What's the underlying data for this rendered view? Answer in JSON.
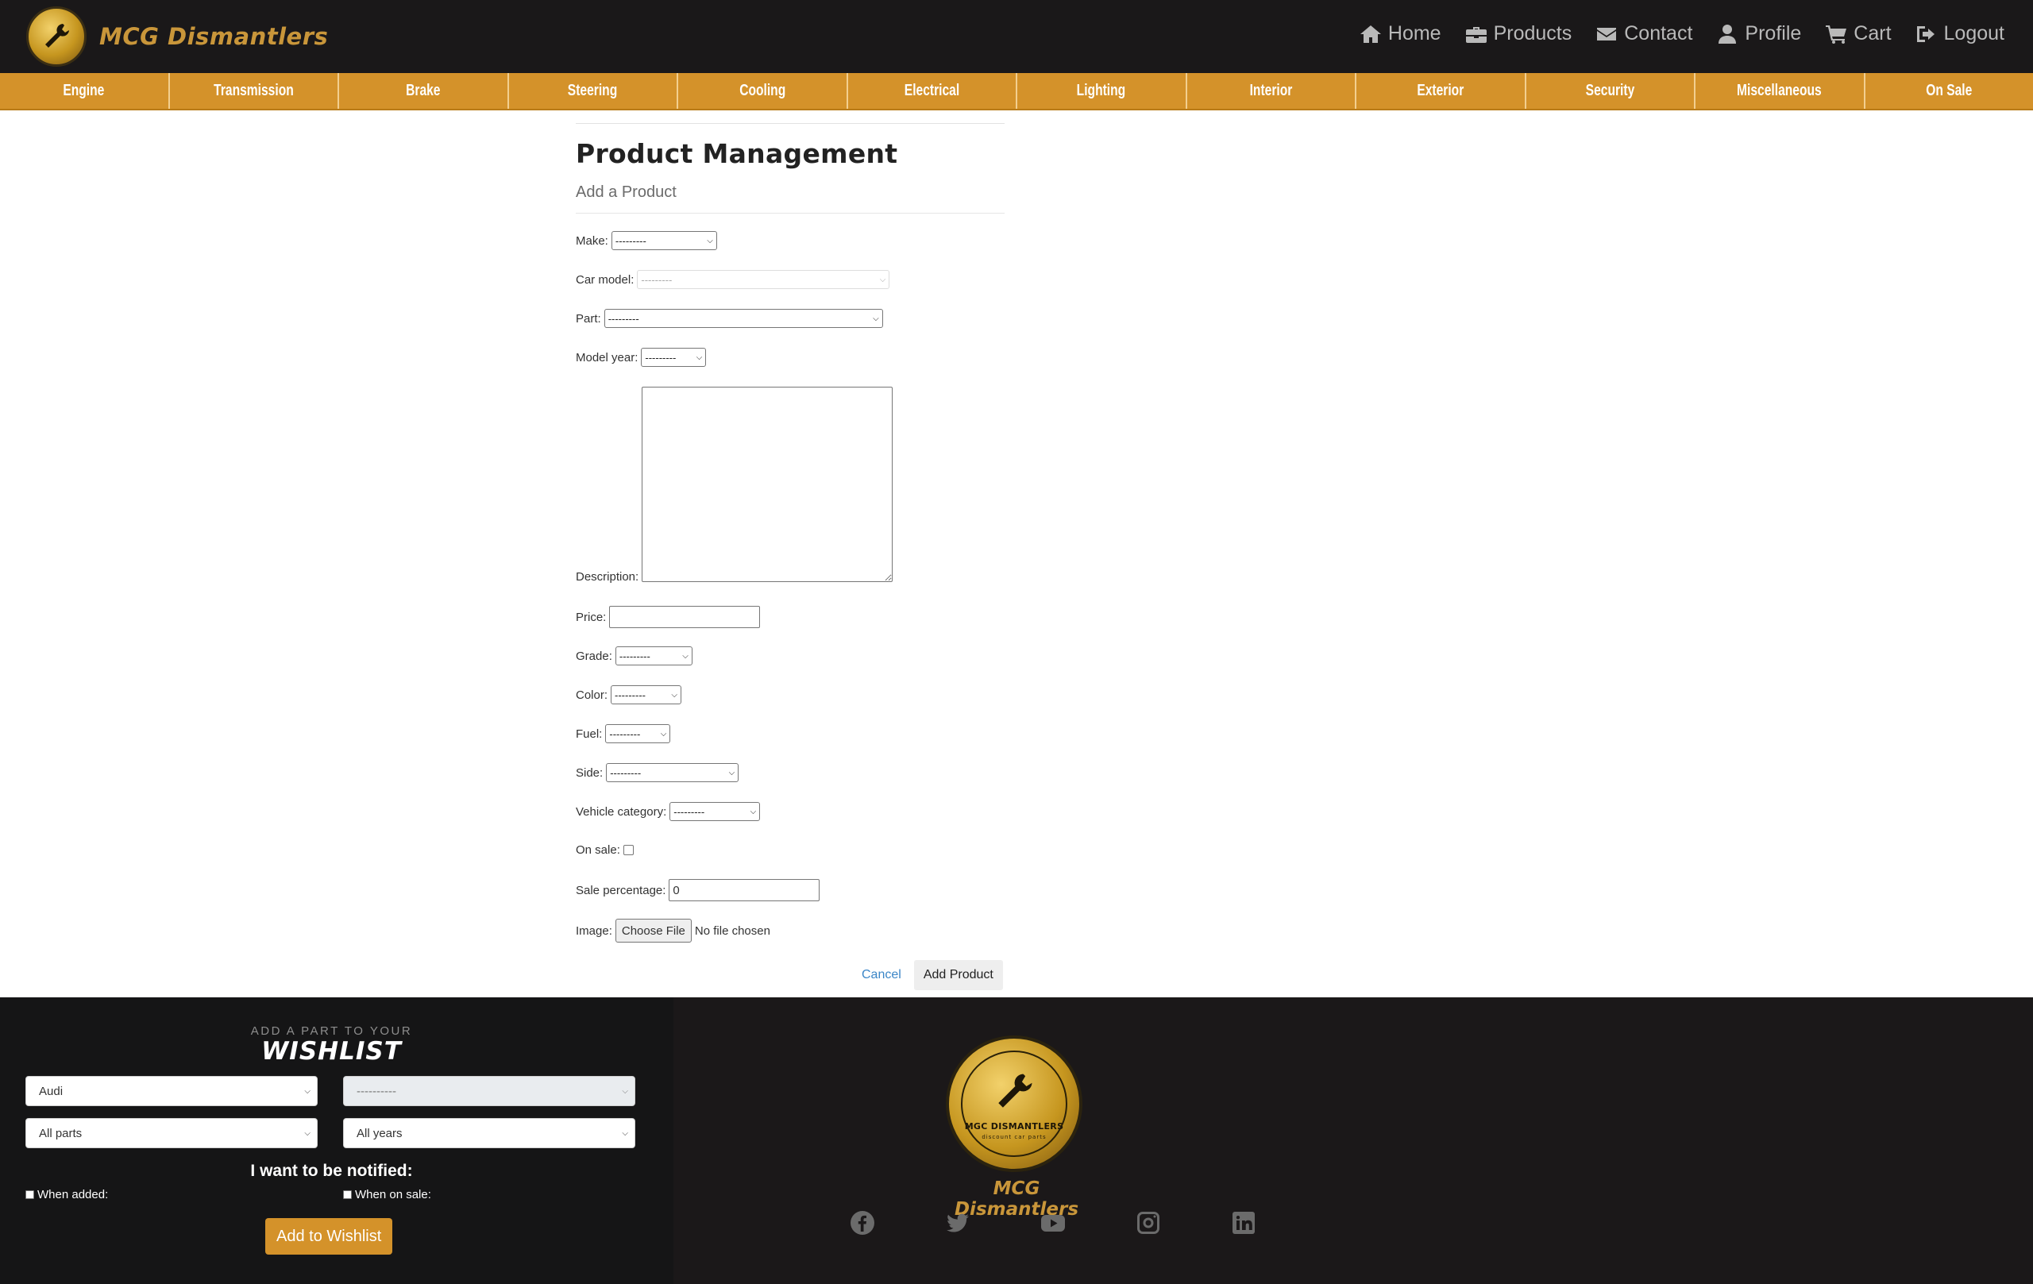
{
  "brand": {
    "name": "MCG Dismantlers",
    "logo_text": "MGC DISMANTLERS",
    "logo_tagline": "discount car parts"
  },
  "nav": [
    {
      "label": "Home",
      "icon": "home-icon"
    },
    {
      "label": "Products",
      "icon": "toolbox-icon"
    },
    {
      "label": "Contact",
      "icon": "envelope-icon"
    },
    {
      "label": "Profile",
      "icon": "user-icon"
    },
    {
      "label": "Cart",
      "icon": "cart-icon"
    },
    {
      "label": "Logout",
      "icon": "logout-icon"
    }
  ],
  "categories": [
    "Engine",
    "Transmission",
    "Brake",
    "Steering",
    "Cooling",
    "Electrical",
    "Lighting",
    "Interior",
    "Exterior",
    "Security",
    "Miscellaneous",
    "On Sale"
  ],
  "page": {
    "title": "Product Management",
    "subtitle": "Add a Product"
  },
  "form": {
    "make_label": "Make:",
    "make_value": "---------",
    "car_model_label": "Car model:",
    "car_model_value": "---------",
    "part_label": "Part:",
    "part_value": "---------",
    "model_year_label": "Model year:",
    "model_year_value": "---------",
    "description_label": "Description:",
    "price_label": "Price:",
    "price_value": "",
    "grade_label": "Grade:",
    "grade_value": "---------",
    "color_label": "Color:",
    "color_value": "---------",
    "fuel_label": "Fuel:",
    "fuel_value": "---------",
    "side_label": "Side:",
    "side_value": "---------",
    "vehicle_category_label": "Vehicle category:",
    "vehicle_category_value": "---------",
    "on_sale_label": "On sale:",
    "sale_percentage_label": "Sale percentage:",
    "sale_percentage_value": "0",
    "image_label": "Image:",
    "choose_file_label": "Choose File",
    "file_status": "No file chosen",
    "cancel_label": "Cancel",
    "submit_label": "Add Product"
  },
  "wishlist": {
    "kicker": "ADD A PART TO YOUR",
    "title": "WISHLIST",
    "make_value": "Audi",
    "model_value": "----------",
    "part_value": "All parts",
    "year_value": "All years",
    "notify_label": "I want to be notified:",
    "when_added_label": "When added:",
    "when_on_sale_label": "When on sale:",
    "button_label": "Add to Wishlist"
  },
  "footer": {
    "brand": "MCG Dismantlers",
    "socials": [
      "facebook-icon",
      "twitter-icon",
      "youtube-icon",
      "instagram-icon",
      "linkedin-icon"
    ]
  },
  "colors": {
    "accent": "#d4922a",
    "header_bg": "#1a1819",
    "brand_gold": "#c9963a"
  }
}
